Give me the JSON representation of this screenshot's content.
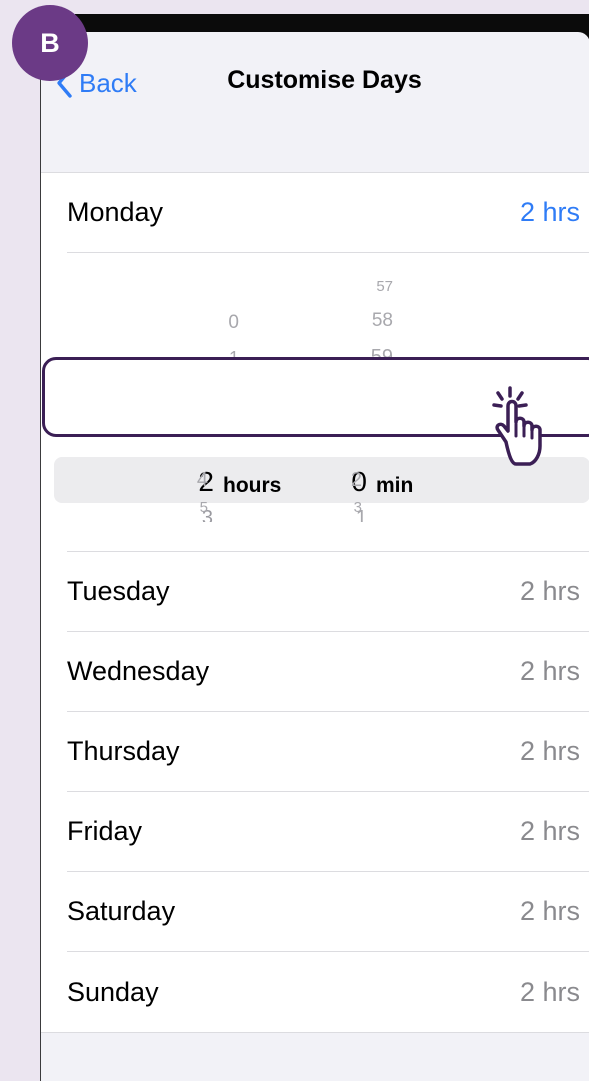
{
  "badge": {
    "letter": "B"
  },
  "nav": {
    "back_label": "Back",
    "title": "Customise Days"
  },
  "monday": {
    "day": "Monday",
    "value": "2 hrs"
  },
  "picker": {
    "hours_selected": "2",
    "hours_unit": "hours",
    "minutes_selected": "0",
    "minutes_unit": "min",
    "hours_above": [
      "0",
      "1"
    ],
    "hours_below": [
      "3",
      "4",
      "5"
    ],
    "minutes_above": [
      "57",
      "58",
      "59"
    ],
    "minutes_below": [
      "1",
      "2",
      "3"
    ]
  },
  "days": [
    {
      "day": "Tuesday",
      "value": "2 hrs"
    },
    {
      "day": "Wednesday",
      "value": "2 hrs"
    },
    {
      "day": "Thursday",
      "value": "2 hrs"
    },
    {
      "day": "Friday",
      "value": "2 hrs"
    },
    {
      "day": "Saturday",
      "value": "2 hrs"
    },
    {
      "day": "Sunday",
      "value": "2 hrs"
    }
  ],
  "colors": {
    "accent": "#2f7cf6",
    "badge": "#6b3a86",
    "focus_frame": "#3b1f55"
  },
  "icons": {
    "back": "chevron-left-icon",
    "tap": "tap-hand-icon"
  }
}
